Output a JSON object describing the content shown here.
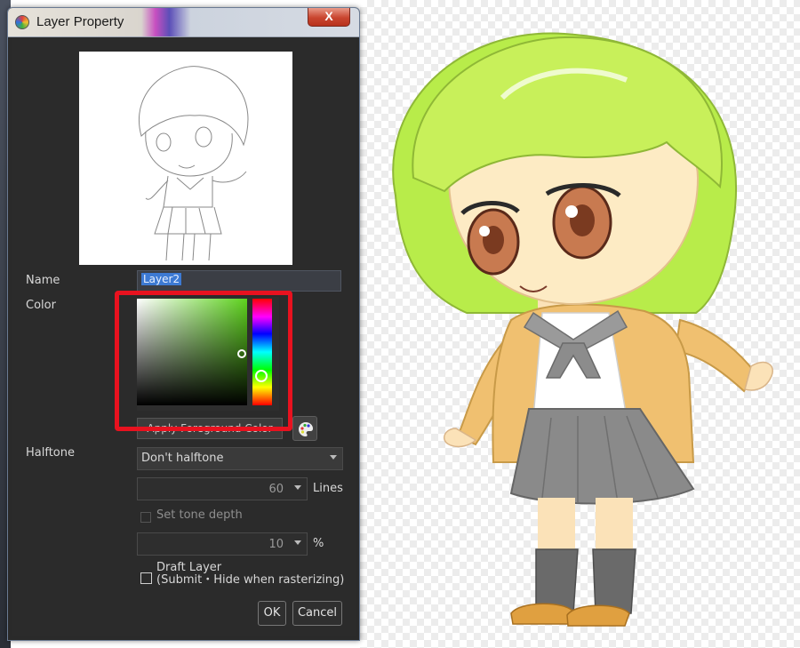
{
  "window": {
    "title": "Layer Property",
    "close_glyph": "X",
    "icon": "app-color-wheel-icon"
  },
  "labels": {
    "name": "Name",
    "color": "Color",
    "halftone": "Halftone"
  },
  "name_field": {
    "value": "Layer2"
  },
  "color": {
    "apply_button_label": "Apply Foreground Color",
    "palette_icon": "palette-icon",
    "picker_hue": "#5ed21e",
    "highlight_color": "#e8121f"
  },
  "halftone": {
    "mode": "Don't halftone",
    "lines_value": "60",
    "lines_unit": "Lines",
    "set_tone_depth_label": "Set tone depth",
    "tone_depth_value": "10",
    "tone_depth_unit": "%"
  },
  "draft_layer": {
    "label_line1": "Draft Layer",
    "label_line2": "(Submit・Hide when rasterizing)",
    "checked": false
  },
  "buttons": {
    "ok": "OK",
    "cancel": "Cancel"
  },
  "artwork": {
    "hair_color": "#c8f05a",
    "skirt_color": "#8a8a8a",
    "cardigan_color": "#f0c070"
  }
}
